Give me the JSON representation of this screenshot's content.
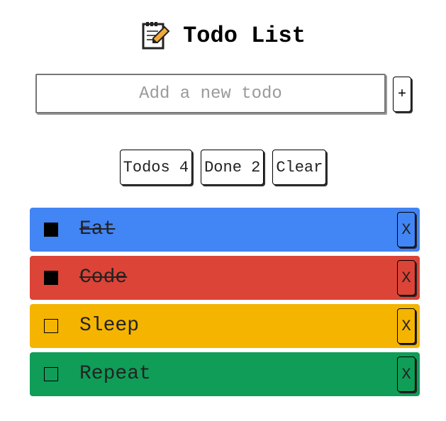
{
  "header": {
    "icon": "memo-pencil-icon",
    "title": "Todo List"
  },
  "add": {
    "placeholder": "Add a new todo",
    "value": "",
    "button_label": "+"
  },
  "filters": [
    {
      "label": "Todos 4"
    },
    {
      "label": "Done 2"
    },
    {
      "label": "Clear"
    }
  ],
  "todos": [
    {
      "text": "Eat",
      "done": true,
      "color": "#4285f4",
      "delete_label": "X"
    },
    {
      "text": "Code",
      "done": true,
      "color": "#db4437",
      "delete_label": "X"
    },
    {
      "text": "Sleep",
      "done": false,
      "color": "#f4b400",
      "delete_label": "X"
    },
    {
      "text": "Repeat",
      "done": false,
      "color": "#0f9d58",
      "delete_label": "X"
    }
  ]
}
